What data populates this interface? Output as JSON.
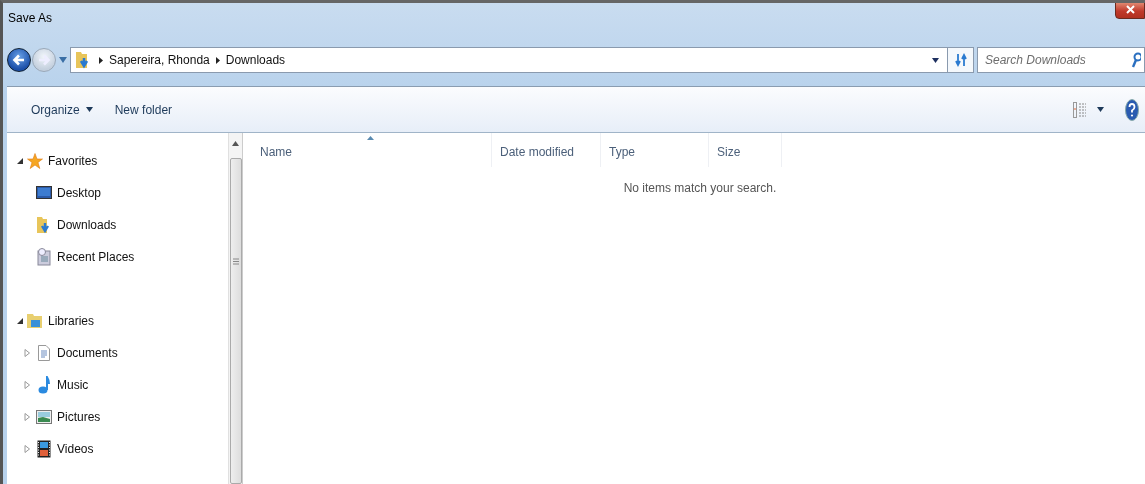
{
  "window": {
    "title": "Save As"
  },
  "address_bar": {
    "crumbs": [
      "Sapereira, Rhonda",
      "Downloads"
    ]
  },
  "search": {
    "placeholder": "Search Downloads"
  },
  "toolbar": {
    "buttons": [
      "Organize",
      "New folder"
    ]
  },
  "navigation": [
    {
      "label": "Favorites",
      "expanded": true,
      "children": [
        {
          "label": "Desktop"
        },
        {
          "label": "Downloads"
        },
        {
          "label": "Recent Places"
        }
      ]
    },
    {
      "label": "Libraries",
      "expanded": true,
      "children": [
        {
          "label": "Documents",
          "expanded": false
        },
        {
          "label": "Music",
          "expanded": false
        },
        {
          "label": "Pictures",
          "expanded": false
        },
        {
          "label": "Videos",
          "expanded": false
        }
      ]
    }
  ],
  "file_list": {
    "columns": [
      {
        "label": "Name",
        "sorted": true
      },
      {
        "label": "Date modified",
        "sorted": false
      },
      {
        "label": "Type",
        "sorted": false
      },
      {
        "label": "Size",
        "sorted": false
      }
    ],
    "empty_message": "No items match your search."
  }
}
